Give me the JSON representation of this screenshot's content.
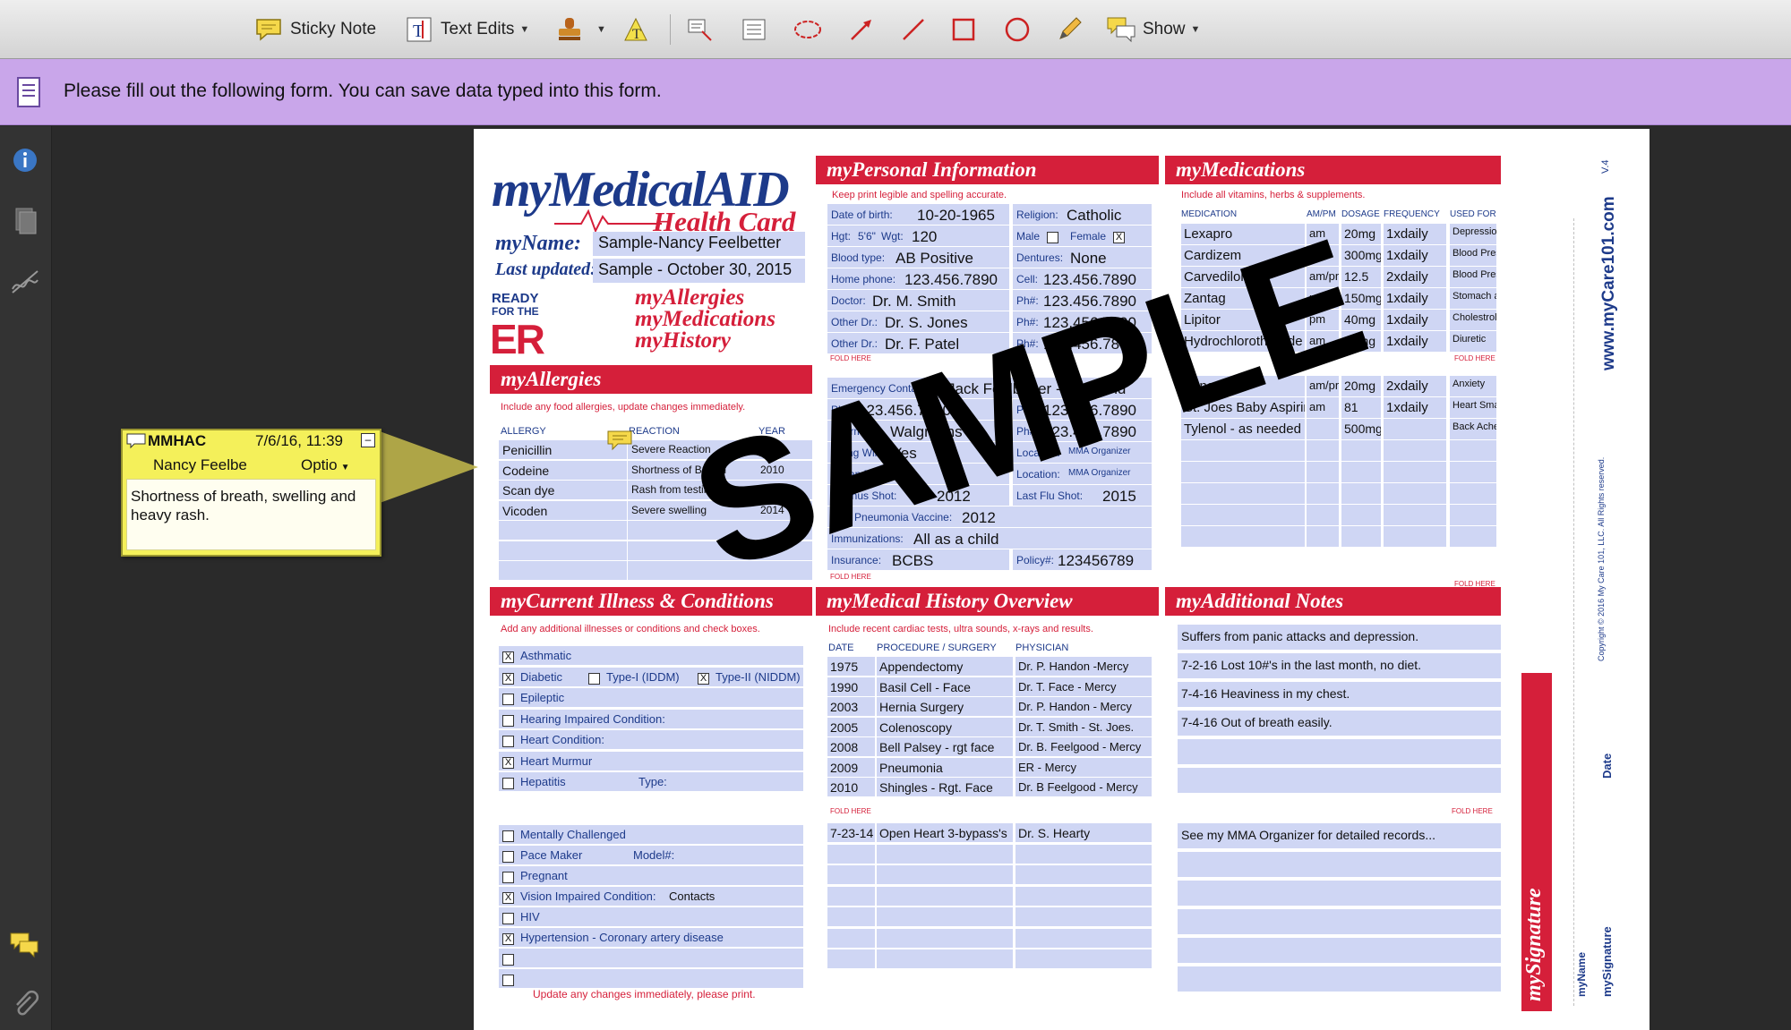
{
  "toolbar": {
    "sticky_note": "Sticky Note",
    "text_edits": "Text Edits",
    "show": "Show"
  },
  "formbar": {
    "message": "Please fill out the following form. You can save data typed into this form."
  },
  "sticky": {
    "author": "MMHAC",
    "date": "7/6/16, 11:39",
    "name": "Nancy Feelbe",
    "options": "Optio",
    "content": "Shortness of breath, swelling and heavy rash."
  },
  "card": {
    "brand_my": "my",
    "brand_main": "MedicalAID",
    "brand_sub": "Health Card",
    "name_label": "myName:",
    "name_value": "Sample-Nancy Feelbetter",
    "updated_label": "Last updated:",
    "updated_value": "Sample - October 30, 2015",
    "ready_1": "READY",
    "ready_2": "FOR THE",
    "er": "ER",
    "links": [
      "myAllergies",
      "myMedications",
      "myHistory"
    ],
    "watermark": "SAMPLE"
  },
  "allergies": {
    "title": "myAllergies",
    "subtitle": "Include any food allergies, update changes immediately.",
    "headers": [
      "ALLERGY",
      "REACTION",
      "YEAR"
    ],
    "rows": [
      [
        "Penicillin",
        "Severe Reaction",
        "2005"
      ],
      [
        "Codeine",
        "Shortness of Breath",
        "2010"
      ],
      [
        "Scan dye",
        "Rash from testing",
        "2012"
      ],
      [
        "Vicoden",
        "Severe swelling",
        "2014"
      ]
    ]
  },
  "personal": {
    "title": "myPersonal Information",
    "subtitle": "Keep print legible and spelling accurate.",
    "dob_label": "Date of birth:",
    "dob": "10-20-1965",
    "religion_label": "Religion:",
    "religion": "Catholic",
    "hgt_label": "Hgt:",
    "hgt": "5'6\"",
    "wgt_label": "Wgt:",
    "wgt": "120",
    "male_label": "Male",
    "female_label": "Female",
    "blood_label": "Blood type:",
    "blood": "AB Positive",
    "dentures_label": "Dentures:",
    "dentures": "None",
    "home_label": "Home phone:",
    "home": "123.456.7890",
    "cell_label": "Cell:",
    "cell": "123.456.7890",
    "doctor_label": "Doctor:",
    "doctor": "Dr. M. Smith",
    "ph_label": "Ph#:",
    "doctor_ph": "123.456.7890",
    "other1_label": "Other Dr.:",
    "other1": "Dr. S. Jones",
    "other1_ph": "123.456.7890",
    "other2_label": "Other Dr.:",
    "other2": "Dr. F. Patel",
    "other2_ph": "123.456.7890",
    "emergency_label": "Emergency Contact:",
    "emergency": "Jack Feelbetter - Husband",
    "emergency_ph": "123.456.7890",
    "emergency_ph2": "123.456.7890",
    "pharmacy_label": "Pharmacy:",
    "pharmacy": "Walgreens",
    "pharmacy_ph": "123.456.7890",
    "living_will_label": "Living Will:",
    "living_will": "Yes",
    "location_label": "Location:",
    "location": "MMA Organizer",
    "organ_label": "Organ Donor:",
    "organ_location_label": "Location:",
    "organ_location": "MMA Organizer",
    "tetanus_label": "Tetanus Shot:",
    "tetanus": "2012",
    "flu_label": "Last Flu Shot:",
    "flu": "2015",
    "pneumonia_label": "Last Pneumonia Vaccine:",
    "pneumonia": "2012",
    "immunizations_label": "Immunizations:",
    "immunizations": "All as a child",
    "insurance_label": "Insurance:",
    "insurance": "BCBS",
    "policy_label": "Policy#:",
    "policy": "123456789"
  },
  "medications": {
    "title": "myMedications",
    "subtitle": "Include all vitamins, herbs & supplements.",
    "headers": [
      "MEDICATION",
      "AM/PM",
      "DOSAGE",
      "FREQUENCY",
      "USED FOR"
    ],
    "rows": [
      [
        "Lexapro",
        "am",
        "20mg",
        "1xdaily",
        "Depression"
      ],
      [
        "Cardizem",
        "am",
        "300mg",
        "1xdaily",
        "Blood Pressure"
      ],
      [
        "Carvedilol",
        "am/pm",
        "12.5",
        "2xdaily",
        "Blood Pressure"
      ],
      [
        "Zantag",
        "pm",
        "150mg",
        "1xdaily",
        "Stomach acid"
      ],
      [
        "Lipitor",
        "pm",
        "40mg",
        "1xdaily",
        "Cholestrol"
      ],
      [
        "Hydrochlorothiazide",
        "am",
        "25mg",
        "1xdaily",
        "Diuretic"
      ],
      [
        "Zanax",
        "am/pm",
        "20mg",
        "2xdaily",
        "Anxiety"
      ],
      [
        "St. Joes Baby Aspirin",
        "am",
        "81",
        "1xdaily",
        "Heart Smart"
      ],
      [
        "Tylenol - as needed",
        "",
        "500mg",
        "",
        "Back Ache"
      ]
    ]
  },
  "illness": {
    "title": "myCurrent Illness & Conditions",
    "subtitle": "Add any additional illnesses or conditions and check boxes.",
    "items": [
      {
        "label": "Asthmatic",
        "checked": "X"
      },
      {
        "label": "Diabetic",
        "checked": "X"
      },
      {
        "label": "Epileptic",
        "checked": ""
      },
      {
        "label": "Hearing Impaired Condition:",
        "checked": ""
      },
      {
        "label": "Heart Condition:",
        "checked": ""
      },
      {
        "label": "Heart Murmur",
        "checked": "X"
      },
      {
        "label": "Hepatitis",
        "checked": ""
      }
    ],
    "type1": "Type-I (IDDM)",
    "type2": "Type-II (NIDDM)",
    "hep_type": "Type:",
    "items2": [
      {
        "label": "Mentally Challenged",
        "checked": ""
      },
      {
        "label": "Pace Maker",
        "checked": ""
      },
      {
        "label": "Pregnant",
        "checked": ""
      },
      {
        "label": "Vision Impaired Condition:",
        "checked": "X"
      },
      {
        "label": "HIV",
        "checked": ""
      },
      {
        "label": "Hypertension - Coronary artery disease",
        "checked": "X"
      }
    ],
    "model_label": "Model#:",
    "vision_value": "Contacts",
    "footer": "Update any changes immediately, please print."
  },
  "history": {
    "title": "myMedical History Overview",
    "subtitle": "Include recent cardiac tests, ultra sounds, x-rays and results.",
    "headers": [
      "DATE",
      "PROCEDURE / SURGERY",
      "PHYSICIAN"
    ],
    "rows": [
      [
        "1975",
        "Appendectomy",
        "Dr. P. Handon -Mercy"
      ],
      [
        "1990",
        "Basil Cell - Face",
        "Dr. T. Face - Mercy"
      ],
      [
        "2003",
        "Hernia Surgery",
        "Dr. P. Handon - Mercy"
      ],
      [
        "2005",
        "Colenoscopy",
        "Dr. T. Smith - St. Joes."
      ],
      [
        "2008",
        "Bell Palsey - rgt face",
        "Dr. B. Feelgood - Mercy"
      ],
      [
        "2009",
        "Pneumonia",
        "ER - Mercy"
      ],
      [
        "2010",
        "Shingles - Rgt. Face",
        "Dr. B Feelgood - Mercy"
      ]
    ],
    "rows2": [
      [
        "7-23-14",
        "Open Heart 3-bypass's",
        "Dr. S. Hearty"
      ]
    ]
  },
  "notes": {
    "title": "myAdditional Notes",
    "lines": [
      "Suffers from panic attacks and depression.",
      "7-2-16 Lost 10#'s in the last month, no diet.",
      "7-4-16 Heaviness in my chest.",
      "7-4-16 Out of breath easily."
    ],
    "lines2": [
      "See my MMA Organizer for detailed records..."
    ]
  },
  "side": {
    "version": "V.4",
    "website": "www.myCare101.com",
    "copyright": "Copyright © 2016 My Care 101, LLC. All Rights reserved.",
    "date_label": "Date",
    "signature_label": "mySignature",
    "name_label": "myName",
    "signature_title": "mySignature"
  },
  "fold": "FOLD HERE"
}
